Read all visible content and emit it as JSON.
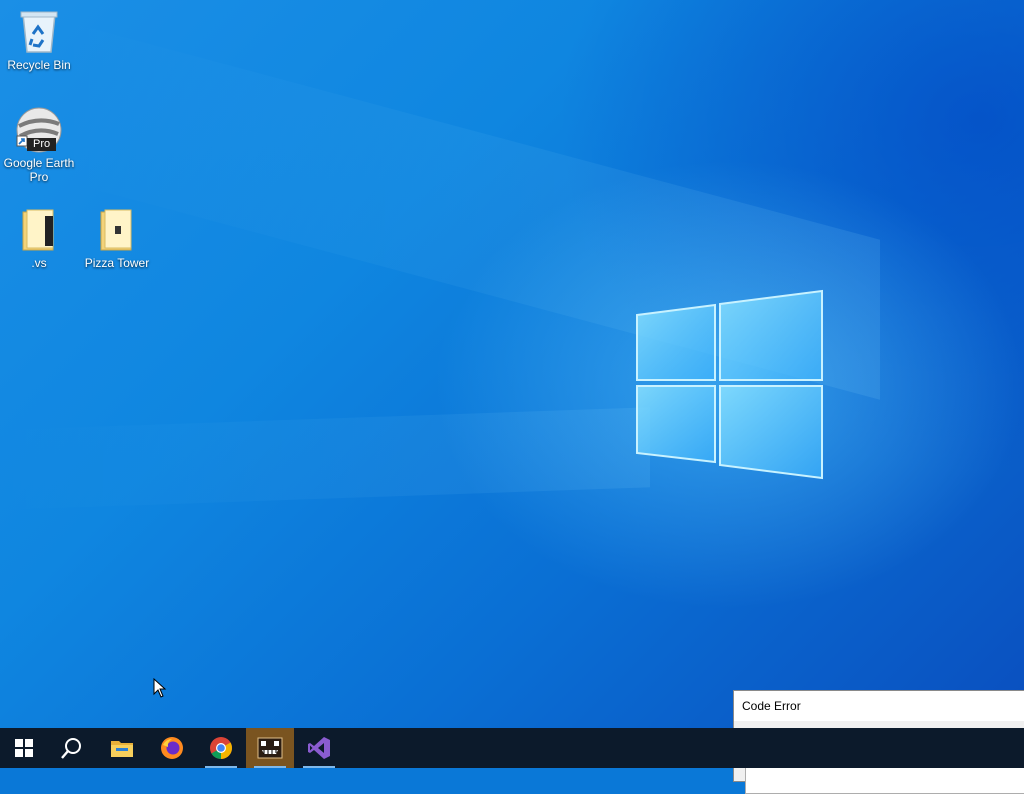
{
  "desktop": {
    "icons": [
      {
        "label": "Recycle Bin",
        "icon": "recycle-bin-icon"
      },
      {
        "label": "Google Earth Pro",
        "badge": "Pro",
        "icon": "google-earth-pro-icon"
      },
      {
        "label": ".vs",
        "icon": "folder-icon"
      },
      {
        "label": "Pizza Tower",
        "icon": "folder-icon"
      }
    ]
  },
  "taskbar": {
    "items": [
      {
        "name": "start",
        "icon": "windows-logo-icon"
      },
      {
        "name": "search",
        "icon": "search-icon"
      },
      {
        "name": "file-explorer",
        "icon": "folder-icon"
      },
      {
        "name": "firefox",
        "icon": "firefox-icon"
      },
      {
        "name": "chrome",
        "icon": "chrome-icon"
      },
      {
        "name": "pizza-tower-game",
        "icon": "game-icon",
        "active": true
      },
      {
        "name": "visual-studio",
        "icon": "visual-studio-icon"
      }
    ]
  },
  "dialog": {
    "title": "Code Error"
  },
  "colors": {
    "wallpaper": "#0a78d7",
    "taskbar": "#0c1a2b",
    "active_task": "#7a5420",
    "underline": "#7fb8ea"
  }
}
